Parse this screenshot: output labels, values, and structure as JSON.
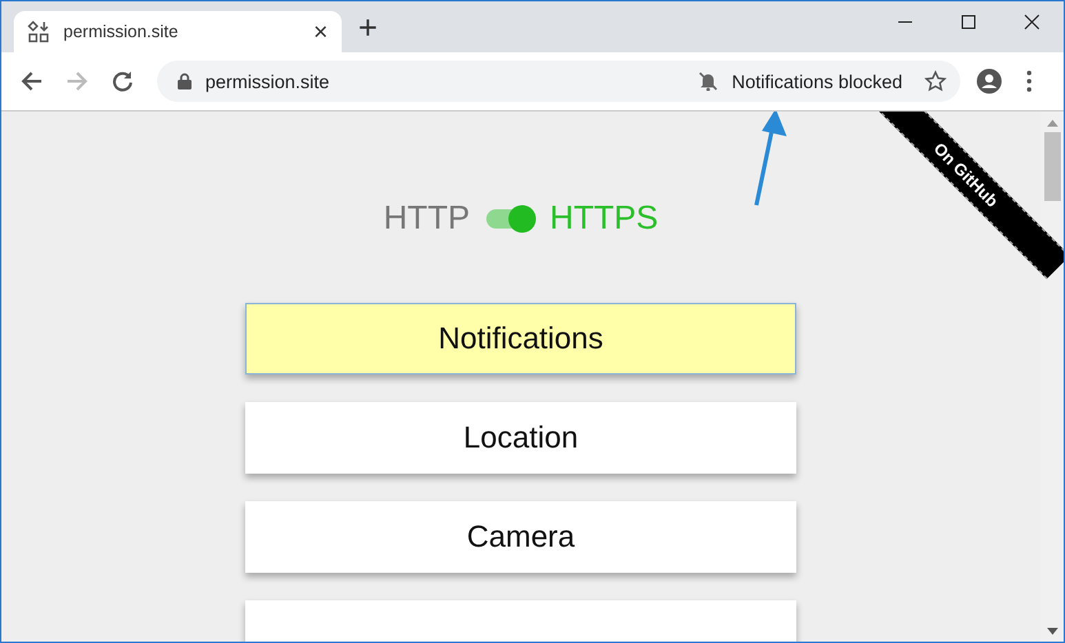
{
  "tab": {
    "title": "permission.site",
    "close": "×",
    "new_tab": "+"
  },
  "address_bar": {
    "url": "permission.site",
    "notice": "Notifications blocked"
  },
  "protocol_toggle": {
    "left_label": "HTTP",
    "right_label": "HTTPS",
    "on": true
  },
  "ribbon": {
    "label": "On GitHub"
  },
  "buttons": [
    {
      "label": "Notifications",
      "selected": true
    },
    {
      "label": "Location",
      "selected": false
    },
    {
      "label": "Camera",
      "selected": false
    },
    {
      "selected": false
    }
  ]
}
